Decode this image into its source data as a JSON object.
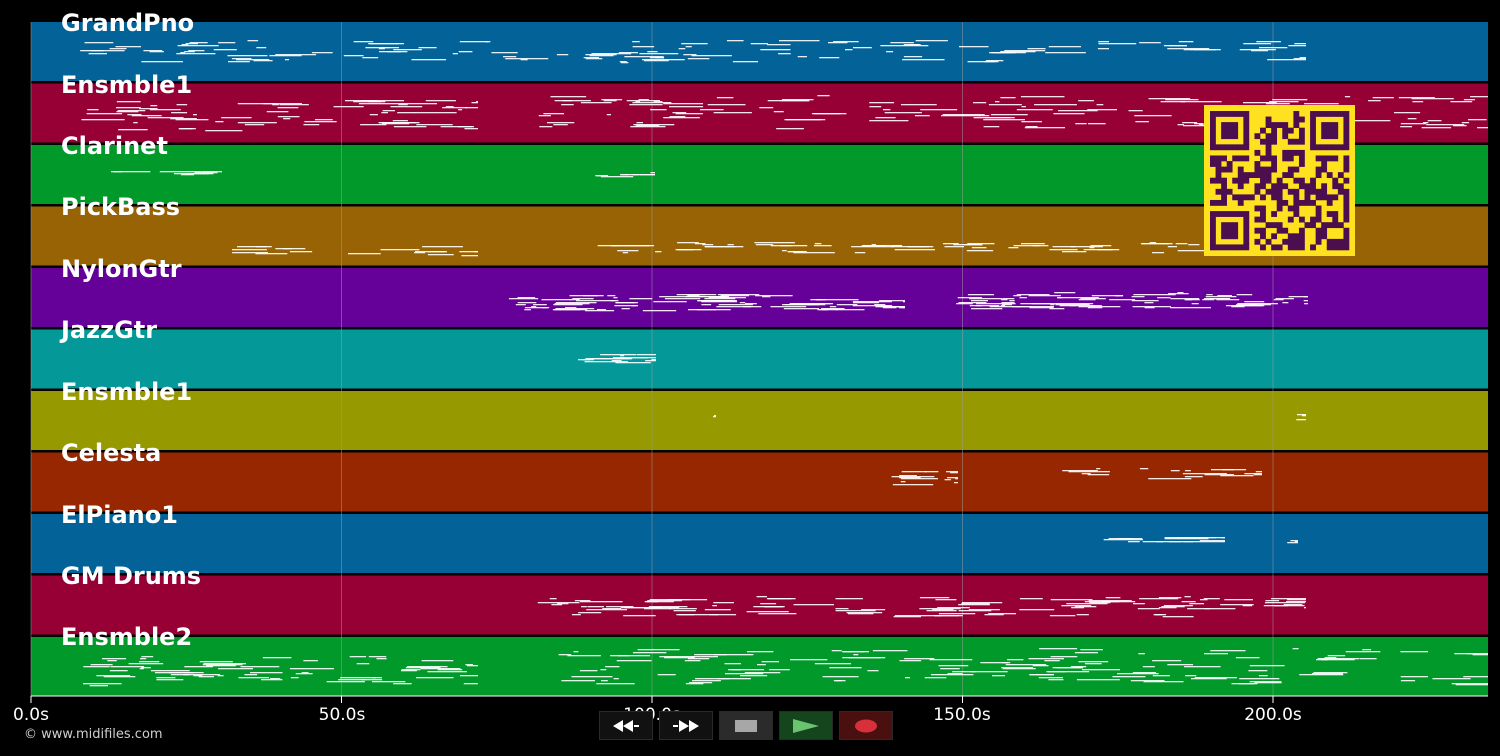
{
  "tracks": [
    {
      "name": "GrandPno",
      "color": "#036297"
    },
    {
      "name": "Ensmble1",
      "color": "#960034"
    },
    {
      "name": "Clarinet",
      "color": "#019a2a"
    },
    {
      "name": "PickBass",
      "color": "#976304"
    },
    {
      "name": "NylonGtr",
      "color": "#650099"
    },
    {
      "name": "JazzGtr",
      "color": "#049998"
    },
    {
      "name": "Ensmble1",
      "color": "#979900"
    },
    {
      "name": "Celesta",
      "color": "#962700"
    },
    {
      "name": "ElPiano1",
      "color": "#036297"
    },
    {
      "name": "GM Drums",
      "color": "#960034"
    },
    {
      "name": "Ensmble2",
      "color": "#019a2a"
    }
  ],
  "timeline": {
    "ticks": [
      "0.0s",
      "50.0s",
      "100.0s",
      "150.0s",
      "200.0s"
    ],
    "tick_values": [
      0,
      50,
      100,
      150,
      200
    ],
    "max_seconds": 235
  },
  "footer": {
    "copyright": "© www.midifiles.com"
  },
  "transport": {
    "buttons": [
      {
        "icon": "rewind-icon",
        "action": "rewind"
      },
      {
        "icon": "fast-forward-icon",
        "action": "fast-forward"
      },
      {
        "icon": "stop-icon",
        "action": "stop"
      },
      {
        "icon": "play-icon",
        "action": "play"
      },
      {
        "icon": "record-icon",
        "action": "record"
      }
    ]
  },
  "qr_code": {
    "icon": "qr-code-icon",
    "foreground": "#4b0e4f",
    "background": "#ffe21f"
  },
  "colors": {
    "background": "#000000",
    "note": "#ffffff",
    "grid": "#9b9b9b"
  }
}
